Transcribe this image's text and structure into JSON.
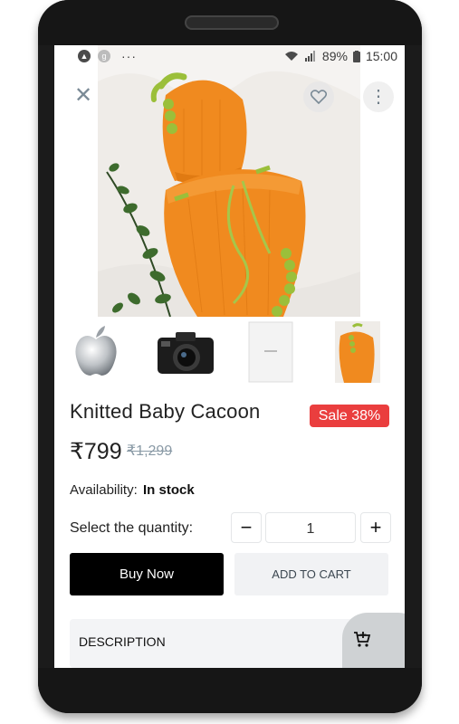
{
  "status_bar": {
    "left_icons": [
      "android-icon",
      "google-icon"
    ],
    "left_g_letter": "g",
    "more_dots": "···",
    "battery": "89%",
    "time": "15:00"
  },
  "hero": {
    "close_glyph": "✕",
    "more_glyph": "⋮"
  },
  "thumbnails": [
    "apple-logo",
    "camera",
    "document",
    "cocoon"
  ],
  "product": {
    "title": "Knitted Baby Cacoon",
    "sale_badge": "Sale 38%",
    "price": "₹799",
    "old_price": "₹1,299",
    "availability_label": "Availability:",
    "availability_value": "In stock",
    "quantity_label": "Select the quantity:",
    "quantity_value": "1",
    "minus_glyph": "−",
    "plus_glyph": "+",
    "buy_now": "Buy Now",
    "add_to_cart": "ADD TO CART",
    "description_label": "DESCRIPTION"
  },
  "colors": {
    "sale_badge": "#ea3e3e",
    "buy_bg": "#000000",
    "cart_bg": "#f1f2f4",
    "product_orange": "#f08a1f",
    "yarn_green": "#9bbf3a"
  }
}
